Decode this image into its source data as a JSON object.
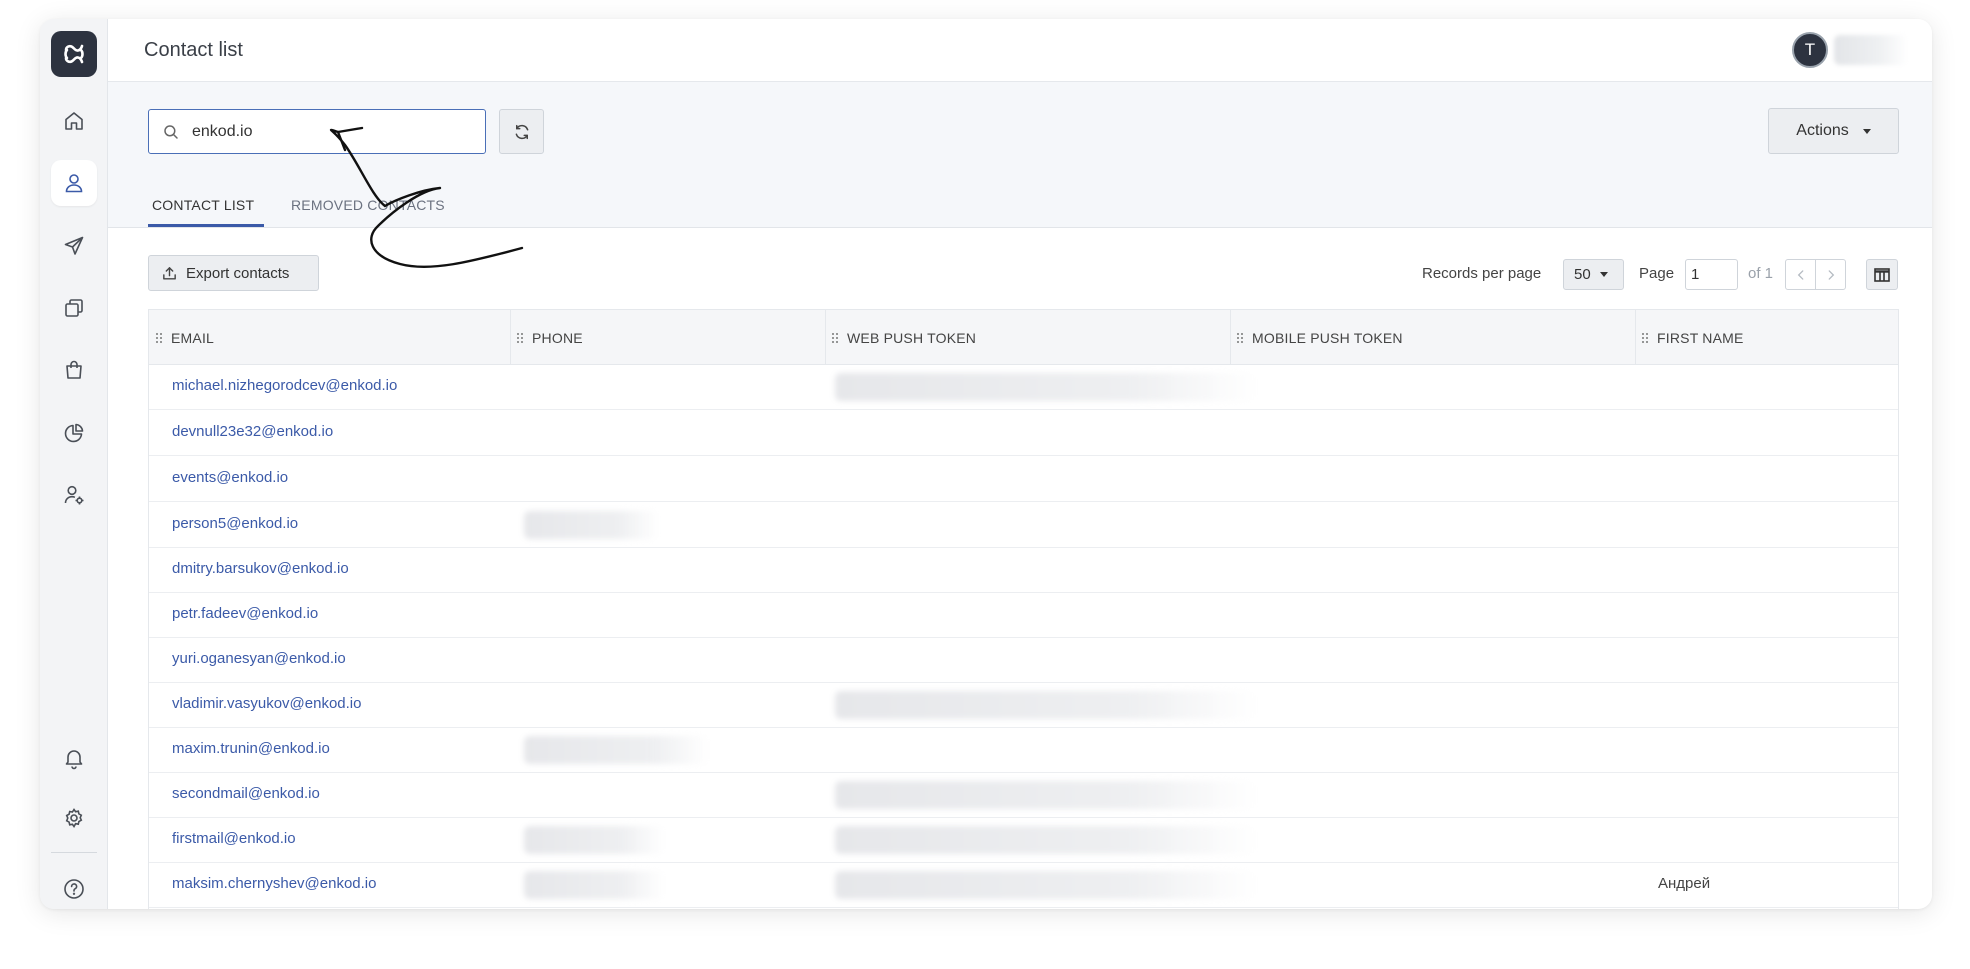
{
  "header": {
    "title": "Contact list",
    "avatar_initial": "T"
  },
  "sidebar": {
    "items": [
      {
        "name": "home",
        "icon": "home-icon"
      },
      {
        "name": "contacts",
        "icon": "user-icon",
        "active": true
      },
      {
        "name": "campaigns",
        "icon": "send-icon"
      },
      {
        "name": "templates",
        "icon": "copy-icon"
      },
      {
        "name": "shop",
        "icon": "bag-icon"
      },
      {
        "name": "analytics",
        "icon": "pie-chart-icon"
      },
      {
        "name": "user-settings",
        "icon": "user-gear-icon"
      },
      {
        "name": "notifications",
        "icon": "bell-icon"
      },
      {
        "name": "settings",
        "icon": "gear-icon"
      },
      {
        "name": "help",
        "icon": "help-icon"
      }
    ]
  },
  "toolbar": {
    "search_value": "enkod.io",
    "actions_label": "Actions"
  },
  "tabs": [
    {
      "label": "CONTACT LIST",
      "active": true
    },
    {
      "label": "REMOVED CONTACTS",
      "active": false
    }
  ],
  "list_controls": {
    "export_label": "Export contacts",
    "records_per_page_label": "Records per page",
    "records_per_page_value": "50",
    "page_label": "Page",
    "page_value": "1",
    "of_label": "of 1"
  },
  "table": {
    "columns": [
      "EMAIL",
      "PHONE",
      "WEB PUSH TOKEN",
      "MOBILE PUSH TOKEN",
      "FIRST NAME"
    ],
    "rows": [
      {
        "email": "michael.nizhegorodcev@enkod.io",
        "first_name": ""
      },
      {
        "email": "devnull23e32@enkod.io",
        "first_name": ""
      },
      {
        "email": "events@enkod.io",
        "first_name": ""
      },
      {
        "email": "person5@enkod.io",
        "first_name": ""
      },
      {
        "email": "dmitry.barsukov@enkod.io",
        "first_name": ""
      },
      {
        "email": "petr.fadeev@enkod.io",
        "first_name": ""
      },
      {
        "email": "yuri.oganesyan@enkod.io",
        "first_name": ""
      },
      {
        "email": "vladimir.vasyukov@enkod.io",
        "first_name": ""
      },
      {
        "email": "maxim.trunin@enkod.io",
        "first_name": ""
      },
      {
        "email": "secondmail@enkod.io",
        "first_name": ""
      },
      {
        "email": "firstmail@enkod.io",
        "first_name": ""
      },
      {
        "email": "maksim.chernyshev@enkod.io",
        "first_name": "Андрей"
      }
    ]
  },
  "colors": {
    "accent": "#3b5aa8",
    "search_border": "#4a6fb7",
    "logo_bg": "#2d3340"
  }
}
